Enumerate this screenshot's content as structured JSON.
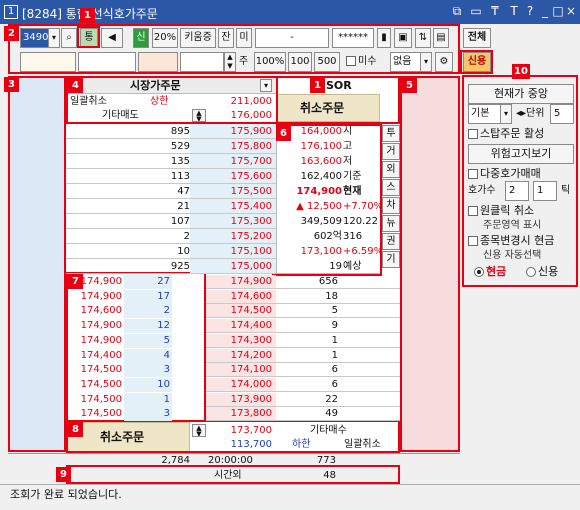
{
  "window": {
    "app_number": "1",
    "title": "[8284] 통합 선식호가주문"
  },
  "toolbar": {
    "code": "3490",
    "tong_label": "통",
    "sin_label": "신",
    "pct_label": "20%",
    "kiwoom_label": "키움증",
    "jan_label": "잔",
    "mi_label": "미",
    "account_field": "-",
    "password_mask": "******",
    "jeonche_label": "전체",
    "sinyong_label": "신용",
    "qty_unit": "주",
    "btn_100pct": "100%",
    "btn_100": "100",
    "btn_500": "500",
    "misu_label": "미수",
    "none_option": "없음"
  },
  "badges": [
    "1",
    "2",
    "3",
    "4",
    "1",
    "5",
    "6",
    "7",
    "8",
    "9",
    "10"
  ],
  "order_panel": {
    "header_market_order": "시장가주문",
    "sor_label": "SOR",
    "cancel_all": "일괄취소",
    "upper_limit_label": "상한",
    "upper_limit_price": "211,000",
    "cancel_order": "취소주문",
    "other_sell": "기타매도",
    "price_176000": "176,000"
  },
  "ask_rows": [
    {
      "qty": "895",
      "price": "175,900"
    },
    {
      "qty": "529",
      "price": "175,800"
    },
    {
      "qty": "135",
      "price": "175,700"
    },
    {
      "qty": "113",
      "price": "175,600"
    },
    {
      "qty": "47",
      "price": "175,500"
    },
    {
      "qty": "21",
      "price": "175,400"
    },
    {
      "qty": "107",
      "price": "175,300"
    },
    {
      "qty": "2",
      "price": "175,200"
    },
    {
      "qty": "10",
      "price": "175,100"
    },
    {
      "qty": "925",
      "price": "175,000"
    }
  ],
  "info_panel": [
    {
      "value": "164,000",
      "label": "시"
    },
    {
      "value": "176,100",
      "label": "고"
    },
    {
      "value": "163,600",
      "label": "저"
    },
    {
      "value": "162,400",
      "label": "기준"
    },
    {
      "value": "174,900",
      "label": "현재"
    },
    {
      "value": "▲ 12,500",
      "label": "+7.70%"
    },
    {
      "value": "349,509",
      "label": "120.22"
    },
    {
      "value": "602억",
      "label": "316"
    },
    {
      "value": "173,100",
      "label": "+6.59%"
    },
    {
      "value": "19",
      "label": "예상"
    }
  ],
  "side_tabs": [
    "투",
    "거",
    "외",
    "스",
    "차",
    "뉴",
    "권",
    "기"
  ],
  "trades": [
    {
      "price": "174,900",
      "qty": "27"
    },
    {
      "price": "174,900",
      "qty": "17"
    },
    {
      "price": "174,600",
      "qty": "2"
    },
    {
      "price": "174,900",
      "qty": "12"
    },
    {
      "price": "174,900",
      "qty": "5"
    },
    {
      "price": "174,400",
      "qty": "4"
    },
    {
      "price": "174,500",
      "qty": "3"
    },
    {
      "price": "174,500",
      "qty": "10"
    },
    {
      "price": "174,500",
      "qty": "1"
    },
    {
      "price": "174,500",
      "qty": "3"
    }
  ],
  "bid_rows": [
    {
      "price": "174,900",
      "qty": "656"
    },
    {
      "price": "174,600",
      "qty": "18"
    },
    {
      "price": "174,500",
      "qty": "5"
    },
    {
      "price": "174,400",
      "qty": "9"
    },
    {
      "price": "174,300",
      "qty": "1"
    },
    {
      "price": "174,200",
      "qty": "1"
    },
    {
      "price": "174,100",
      "qty": "6"
    },
    {
      "price": "174,000",
      "qty": "6"
    },
    {
      "price": "173,900",
      "qty": "22"
    },
    {
      "price": "173,800",
      "qty": "49"
    }
  ],
  "bottom_panel": {
    "cancel_order": "취소주문",
    "price_173700": "173,700",
    "other_buy": "기타매수",
    "lower_limit_price": "113,700",
    "lower_limit_label": "하한",
    "cancel_all": "일괄취소",
    "total_ask": "2,784",
    "time": "20:00:00",
    "total_bid": "773",
    "after_hours": "시간외",
    "after_hours_qty": "48"
  },
  "right_panel": {
    "center_current": "현재가 중앙",
    "basic": "기본",
    "unit_label": "단위",
    "unit_value": "5",
    "stop_order": "스탑주문 활성",
    "dangerous_view": "위험고지보기",
    "multi_quote": "다중호가매매",
    "quote_count_label": "호가수",
    "quote_count": "2",
    "tick_value": "1",
    "tick_label": "틱",
    "one_click_cancel": "원클릭 취소",
    "order_area_display": "주문영역 표시",
    "stock_change_cash": "종목변경시 현금",
    "credit_auto_select": "신용 자동선택",
    "cash": "현금",
    "credit": "신용"
  },
  "status": {
    "message": "조회가 완료 되었습니다."
  }
}
